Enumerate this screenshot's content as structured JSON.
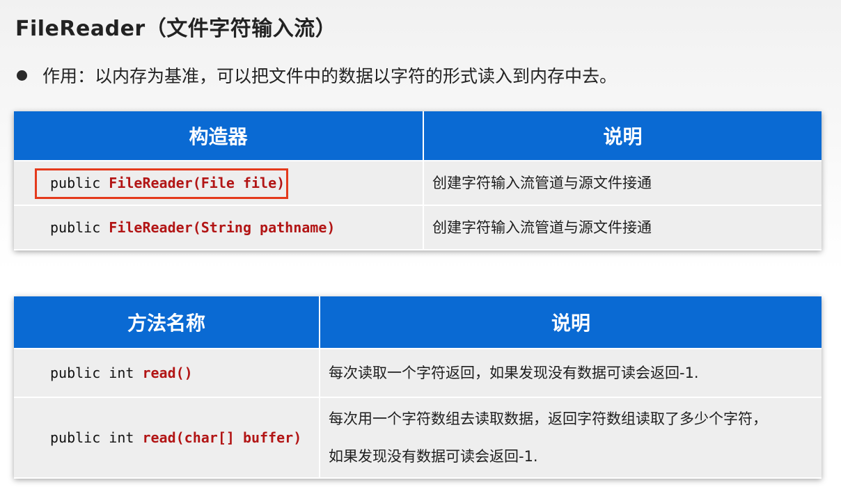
{
  "title": "FileReader（文件字符输入流）",
  "bullet": {
    "text": "作用：以内存为基准，可以把文件中的数据以字符的形式读入到内存中去。"
  },
  "constructors_table": {
    "headers": [
      "构造器",
      "说明"
    ],
    "rows": [
      {
        "modifier": "public",
        "signature": "FileReader(File file)",
        "description": "创建字符输入流管道与源文件接通",
        "highlighted": true
      },
      {
        "modifier": "public",
        "signature": "FileReader(String pathname)",
        "description": "创建字符输入流管道与源文件接通",
        "highlighted": false
      }
    ]
  },
  "methods_table": {
    "headers": [
      "方法名称",
      "说明"
    ],
    "rows": [
      {
        "modifier": "public int",
        "signature": "read()",
        "description_lines": [
          "每次读取一个字符返回，如果发现没有数据可读会返回-1."
        ]
      },
      {
        "modifier": "public int",
        "signature": "read(char[] buffer)",
        "description_lines": [
          "每次用一个字符数组去读取数据，返回字符数组读取了多少个字符，",
          "如果发现没有数据可读会返回-1."
        ]
      }
    ]
  },
  "colors": {
    "header_bg": "#0a6ad3",
    "code_highlight": "#b21515",
    "annotation_box": "#e43a1c",
    "row_bg": "#eeeeee"
  }
}
